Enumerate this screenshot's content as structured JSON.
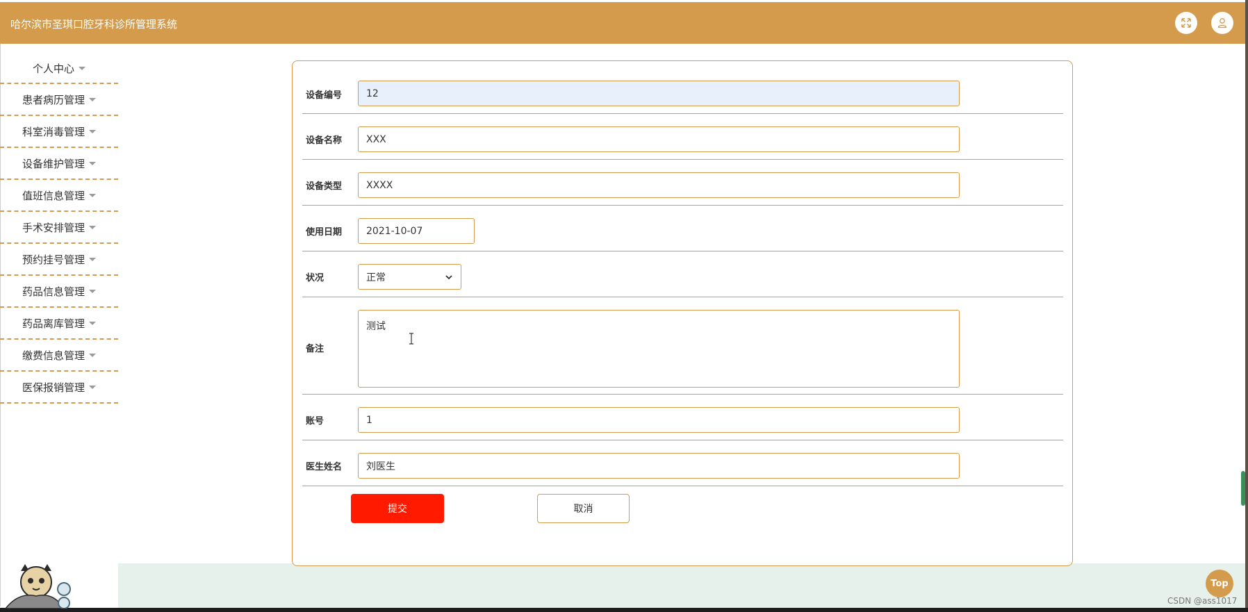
{
  "header": {
    "title": "哈尔滨市圣琪口腔牙科诊所管理系统",
    "fullscreen_icon": "fullscreen-icon",
    "user_icon": "user-icon"
  },
  "sidebar": {
    "items": [
      {
        "label": "个人中心"
      },
      {
        "label": "患者病历管理"
      },
      {
        "label": "科室消毒管理"
      },
      {
        "label": "设备维护管理"
      },
      {
        "label": "值班信息管理"
      },
      {
        "label": "手术安排管理"
      },
      {
        "label": "预约挂号管理"
      },
      {
        "label": "药品信息管理"
      },
      {
        "label": "药品离库管理"
      },
      {
        "label": "缴费信息管理"
      },
      {
        "label": "医保报销管理"
      }
    ]
  },
  "form": {
    "fields": {
      "device_no": {
        "label": "设备编号",
        "value": "12"
      },
      "device_name": {
        "label": "设备名称",
        "value": "XXX"
      },
      "device_type": {
        "label": "设备类型",
        "value": "XXXX"
      },
      "use_date": {
        "label": "使用日期",
        "value": "2021-10-07"
      },
      "status": {
        "label": "状况",
        "value": "正常"
      },
      "remark": {
        "label": "备注",
        "value": "测试"
      },
      "account": {
        "label": "账号",
        "value": "1"
      },
      "doctor_name": {
        "label": "医生姓名",
        "value": "刘医生"
      }
    },
    "submit_label": "提交",
    "cancel_label": "取消"
  },
  "float": {
    "top_label": "Top"
  },
  "watermark": "CSDN @ass1017",
  "colors": {
    "accent": "#d39b4b",
    "submit": "#ff1a00",
    "footer": "#e6f1ec"
  }
}
